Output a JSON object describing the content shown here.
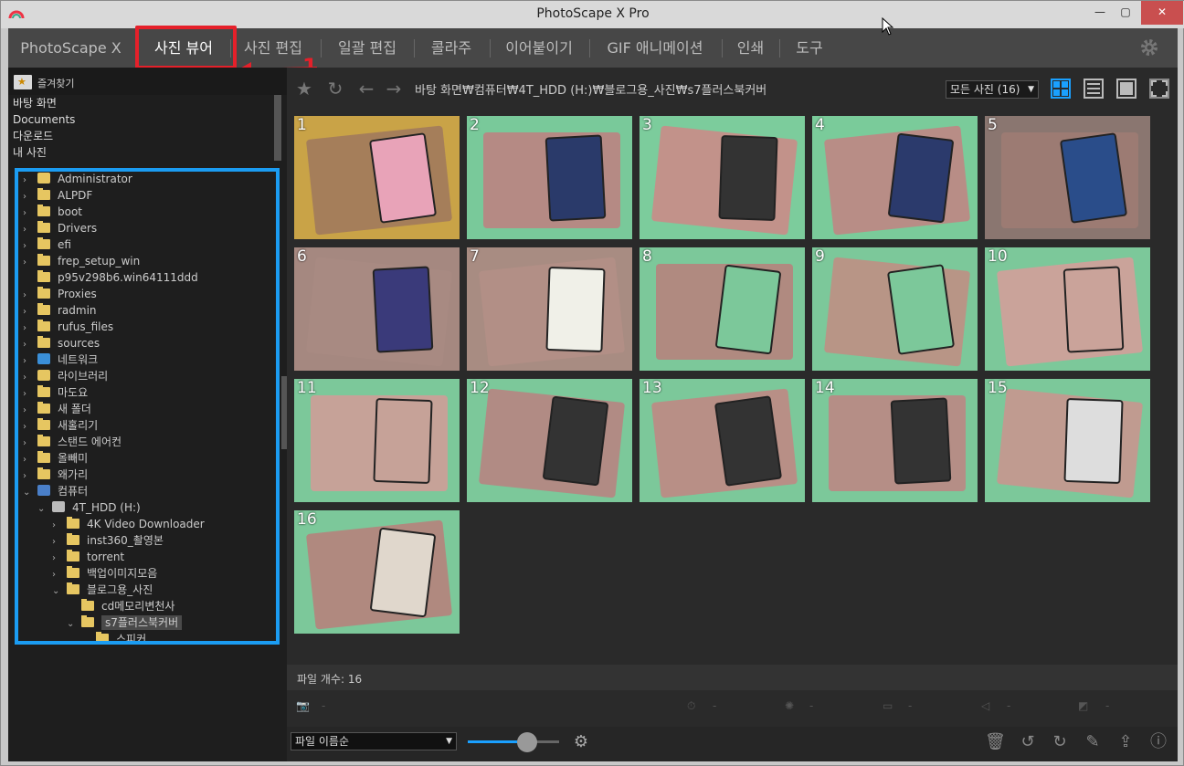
{
  "window": {
    "title": "PhotoScape X Pro",
    "min": "—",
    "max": "▢",
    "close": "✕"
  },
  "menu": {
    "items": [
      "PhotoScape X",
      "사진 뷰어",
      "사진 편집",
      "일괄 편집",
      "콜라주",
      "이어붙이기",
      "GIF 애니메이션",
      "인쇄",
      "도구"
    ],
    "active_index": 1,
    "annotation_number": "1"
  },
  "sidebar": {
    "favorites_label": "즐겨찾기",
    "quick": [
      "바탕 화면",
      "Documents",
      "다운로드",
      "내 사진"
    ],
    "tree": [
      {
        "label": "Administrator",
        "level": 0,
        "arrow": "›",
        "icon": "user-folder"
      },
      {
        "label": "ALPDF",
        "level": 0,
        "arrow": "›",
        "icon": "folder"
      },
      {
        "label": "boot",
        "level": 0,
        "arrow": "›",
        "icon": "folder"
      },
      {
        "label": "Drivers",
        "level": 0,
        "arrow": "›",
        "icon": "folder"
      },
      {
        "label": "efi",
        "level": 0,
        "arrow": "›",
        "icon": "folder"
      },
      {
        "label": "frep_setup_win",
        "level": 0,
        "arrow": "›",
        "icon": "folder"
      },
      {
        "label": "p95v298b6.win64111ddd",
        "level": 0,
        "arrow": "",
        "icon": "folder"
      },
      {
        "label": "Proxies",
        "level": 0,
        "arrow": "›",
        "icon": "folder"
      },
      {
        "label": "radmin",
        "level": 0,
        "arrow": "›",
        "icon": "folder"
      },
      {
        "label": "rufus_files",
        "level": 0,
        "arrow": "›",
        "icon": "folder"
      },
      {
        "label": "sources",
        "level": 0,
        "arrow": "›",
        "icon": "folder"
      },
      {
        "label": "네트워크",
        "level": 0,
        "arrow": "›",
        "icon": "network"
      },
      {
        "label": "라이브러리",
        "level": 0,
        "arrow": "›",
        "icon": "library"
      },
      {
        "label": "마도요",
        "level": 0,
        "arrow": "›",
        "icon": "folder"
      },
      {
        "label": "새 폴더",
        "level": 0,
        "arrow": "›",
        "icon": "folder"
      },
      {
        "label": "새홀리기",
        "level": 0,
        "arrow": "›",
        "icon": "folder"
      },
      {
        "label": "스탠드 에어컨",
        "level": 0,
        "arrow": "›",
        "icon": "folder"
      },
      {
        "label": "올빼미",
        "level": 0,
        "arrow": "›",
        "icon": "folder"
      },
      {
        "label": "왜가리",
        "level": 0,
        "arrow": "›",
        "icon": "folder"
      },
      {
        "label": "컴퓨터",
        "level": 0,
        "arrow": "⌄",
        "icon": "computer"
      },
      {
        "label": "4T_HDD (H:)",
        "level": 1,
        "arrow": "⌄",
        "icon": "drive"
      },
      {
        "label": "4K Video Downloader",
        "level": 2,
        "arrow": "›",
        "icon": "folder"
      },
      {
        "label": "inst360_촬영본",
        "level": 2,
        "arrow": "›",
        "icon": "folder"
      },
      {
        "label": "torrent",
        "level": 2,
        "arrow": "›",
        "icon": "folder"
      },
      {
        "label": "백업이미지모음",
        "level": 2,
        "arrow": "›",
        "icon": "folder"
      },
      {
        "label": "블로그용_사진",
        "level": 2,
        "arrow": "⌄",
        "icon": "folder"
      },
      {
        "label": "cd메모리변천사",
        "level": 3,
        "arrow": "",
        "icon": "folder"
      },
      {
        "label": "s7플러스북커버",
        "level": 3,
        "arrow": "⌄",
        "icon": "folder",
        "selected": true
      },
      {
        "label": "스피커",
        "level": 4,
        "arrow": "",
        "icon": "folder"
      }
    ]
  },
  "toolbar": {
    "path": "바탕 화면₩컴퓨터₩4T_HDD (H:)₩블로그용_사진₩s7플러스북커버",
    "filter": "모든 사진 (16)"
  },
  "thumbnails": [
    {
      "n": "1",
      "bg": "#c9a347",
      "case": "#a57e5a",
      "screen": "#e8a3b8"
    },
    {
      "n": "2",
      "bg": "#79c99a",
      "case": "#b58a84",
      "screen": "#2a3a6a"
    },
    {
      "n": "3",
      "bg": "#7ccc9c",
      "case": "#c2928a",
      "screen": "#333"
    },
    {
      "n": "4",
      "bg": "#7acb9a",
      "case": "#b88d86",
      "screen": "#2b3a6c"
    },
    {
      "n": "5",
      "bg": "#8a7670",
      "case": "#9c7b73",
      "screen": "#2a4d8a"
    },
    {
      "n": "6",
      "bg": "#a58880",
      "case": "#a88a82",
      "screen": "#3a3a7a"
    },
    {
      "n": "7",
      "bg": "#a88c82",
      "case": "#b28f86",
      "screen": "#f0f0e8"
    },
    {
      "n": "8",
      "bg": "#7cc89a",
      "case": "#b08a80",
      "screen": "#7cc89a"
    },
    {
      "n": "9",
      "bg": "#7cc89a",
      "case": "#b89586",
      "screen": "#7cc89a"
    },
    {
      "n": "10",
      "bg": "#7cc89a",
      "case": "#caa39a",
      "screen": "#caa39a"
    },
    {
      "n": "11",
      "bg": "#7cc89a",
      "case": "#c6a298",
      "screen": "#c6a298"
    },
    {
      "n": "12",
      "bg": "#7cc89a",
      "case": "#b18b84",
      "screen": "#333"
    },
    {
      "n": "13",
      "bg": "#7cc89a",
      "case": "#b88f86",
      "screen": "#333"
    },
    {
      "n": "14",
      "bg": "#7cc89a",
      "case": "#b58e86",
      "screen": "#333"
    },
    {
      "n": "15",
      "bg": "#7cc89a",
      "case": "#c09b90",
      "screen": "#ddd"
    },
    {
      "n": "16",
      "bg": "#7cc89a",
      "case": "#b0897f",
      "screen": "#e0d7cc"
    }
  ],
  "status": {
    "file_count": "파일 개수: 16"
  },
  "exif": [
    "-",
    "-",
    "-",
    "-",
    "-",
    "-"
  ],
  "bottom": {
    "sort": "파일 이름순",
    "zoom_percent": 65
  },
  "colors": {
    "accent": "#1aa0ff",
    "annotation_red": "#e5202a",
    "annotation_blue": "#1b9cf2"
  }
}
